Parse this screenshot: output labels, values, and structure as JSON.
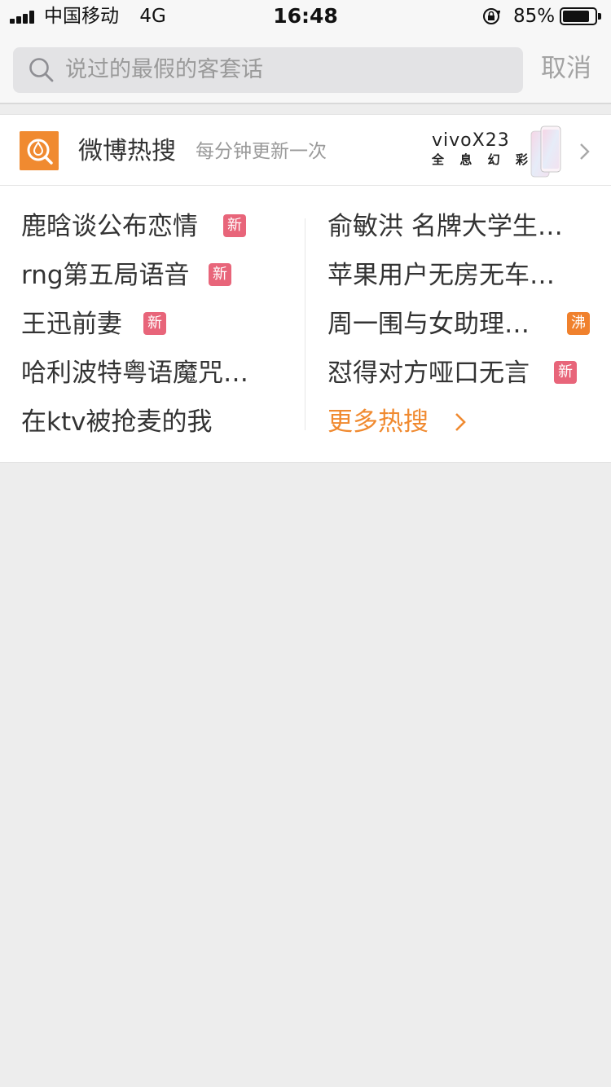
{
  "status_bar": {
    "carrier": "中国移动",
    "network": "4G",
    "time": "16:48",
    "battery_percent": "85%",
    "battery_level": 0.85
  },
  "search": {
    "placeholder": "说过的最假的客套话",
    "cancel_label": "取消"
  },
  "hot_header": {
    "title": "微博热搜",
    "subtitle": "每分钟更新一次",
    "ad": {
      "brand": "vivo",
      "model": "X23",
      "tagline": [
        "全",
        "息",
        "幻",
        "彩"
      ]
    }
  },
  "hot_list": {
    "left": [
      {
        "text": "鹿晗谈公布恋情",
        "badge": "新"
      },
      {
        "text": "rng第五局语音",
        "badge": "新"
      },
      {
        "text": "王迅前妻",
        "badge": "新"
      },
      {
        "text": "哈利波特粤语魔咒…",
        "badge": ""
      },
      {
        "text": "在ktv被抢麦的我",
        "badge": ""
      }
    ],
    "right": [
      {
        "text": "俞敏洪 名牌大学生…",
        "badge": ""
      },
      {
        "text": "苹果用户无房无车…",
        "badge": ""
      },
      {
        "text": "周一围与女助理…",
        "badge": "沸"
      },
      {
        "text": "怼得对方哑口无言",
        "badge": "新"
      }
    ],
    "more_label": "更多热搜"
  },
  "colors": {
    "accent": "#f08a30",
    "badge_new": "#e8657a",
    "badge_hot": "#f0812d",
    "background": "#ededed"
  },
  "icons": {
    "search": "search-icon",
    "hot_logo": "flame-search-icon",
    "chevron": "chevron-right-icon",
    "lock": "rotation-lock-icon"
  }
}
